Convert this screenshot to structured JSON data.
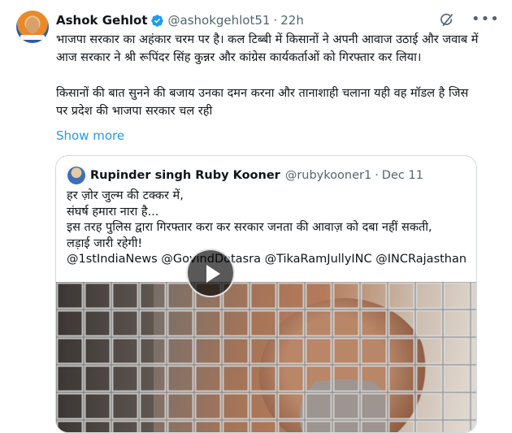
{
  "tweet": {
    "author_name": "Ashok Gehlot",
    "handle": "@ashokgehlot51",
    "separator": "·",
    "time": "22h",
    "paragraphs": [
      "भाजपा सरकार का अहंकार चरम पर है। कल टिब्बी में किसानों ने अपनी आवाज उठाई और जवाब में आज सरकार ने श्री रूपिंदर सिंह कुन्नर और कांग्रेस कार्यकर्ताओं को गिरफ्तार कर लिया।",
      "किसानों की बात सुनने की बजाय उनका दमन करना और तानाशाही चलाना यही वह मॉडल है जिस पर प्रदेश की भाजपा सरकार चल रही"
    ],
    "show_more_label": "Show more",
    "icons": {
      "verified": "verified-badge-icon",
      "grok": "grok-icon",
      "more": "more-options-icon"
    },
    "colors": {
      "link": "#1d9bf0",
      "secondary_text": "#536471",
      "verified": "#1d9bf0"
    }
  },
  "quote": {
    "author_name": "Rupinder singh Ruby Kooner",
    "handle": "@rubykooner1",
    "separator": "·",
    "date": "Dec 11",
    "lines": [
      "हर ज़ोर जुल्म की टक्कर में,",
      "संघर्ष हमारा नारा है...",
      "इस तरह पुलिस द्वारा गिरफ्तार करा कर सरकार जनता की आवाज़ को दबा नहीं सकती,",
      "लड़ाई जारी रहेगी!",
      "@1stIndiaNews @GovindDotasra @TikaRamJullyINC @INCRajasthan ..."
    ],
    "media": {
      "type": "video",
      "icon": "play-icon"
    }
  }
}
